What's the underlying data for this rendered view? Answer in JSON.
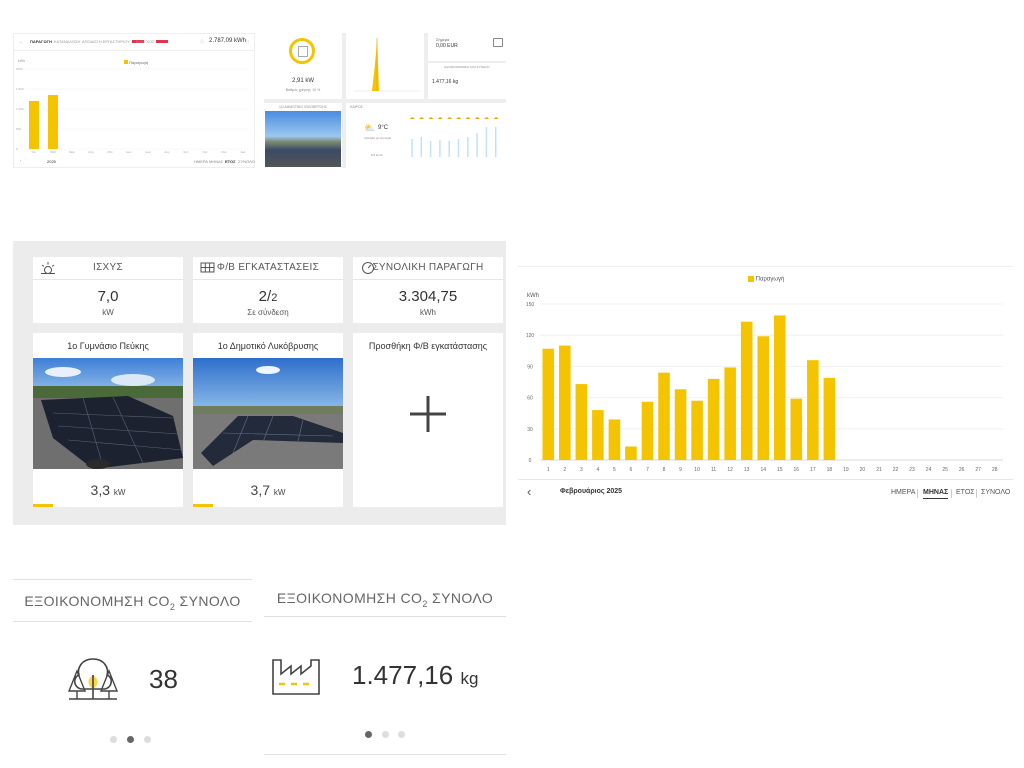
{
  "mini_top_left": {
    "tabs": [
      "ΠΑΡΑΓΩΓΗ",
      "ΚΑΤΑΝΑΛΩΣΗ",
      "ΑΠΟΔΟΣΗ ΕΡΓΑΣΤΗΡΙΟΥ",
      "ΕΛΕΓΧΟΣ"
    ],
    "total": "2.787,09 kWh",
    "legend": "Παραγωγή",
    "y_unit": "kWh",
    "y_ticks": [
      "2000",
      "1.500",
      "1.000",
      "500",
      "0"
    ],
    "months": [
      "Ιαν",
      "Φεβ",
      "Μαρ",
      "Απρ",
      "Μαϊ",
      "Ιουν",
      "Ιουλ",
      "Αυγ",
      "Σεπ",
      "Οκτ",
      "Νοε",
      "Δεκ"
    ],
    "year": "2025",
    "nav": [
      "ΗΜΕΡΑ",
      "ΜΗΝΑΣ",
      "ΕΤΟΣ",
      "ΣΥΝΟΛΟ"
    ],
    "active_nav": "ΕΤΟΣ"
  },
  "mini_top_right": {
    "power": "2,91 kW",
    "efficiency": "Βαθμός χρήσης: 19 %",
    "today_label": "Σήμερα",
    "today_value": "0,00 EUR",
    "co2_label": "ΕΞΟΙΚΟΝΟΜΗΣΗ CO2 ΣΥΝΟΛΟ",
    "co2_value": "1.477,16 kg",
    "school_label": "1Ο ΔΗΜΟΤΙΚΟ ΛΥΚΟΒΡΥΣΗΣ",
    "weather_label": "ΚΑΙΡΟΣ",
    "temp": "9°C",
    "weather_desc": "Λιακάδα με σύννεφα",
    "wind": "8.0 km/h"
  },
  "cards": {
    "power": {
      "title": "ΙΣΧΥΣ",
      "value": "7,0",
      "unit": "kW"
    },
    "plants": {
      "title": "Φ/Β ΕΓΚΑΤΑΣΤΑΣΕΙΣ",
      "value": "2/",
      "value_suffix": "2",
      "status": "Σε σύνδεση"
    },
    "total": {
      "title": "ΣΥΝΟΛΙΚΗ ΠΑΡΑΓΩΓΗ",
      "value": "3.304,75",
      "unit": "kWh"
    }
  },
  "plants": [
    {
      "name": "1ο Γυμνάσιο Πεύκης",
      "value": "3,3",
      "unit": "kW"
    },
    {
      "name": "1ο Δημοτικό Λυκόβρυσης",
      "value": "3,7",
      "unit": "kW"
    }
  ],
  "add_plant": {
    "label": "Προσθήκη Φ/Β εγκατάστασης",
    "icon": "plus-icon"
  },
  "chart_data": {
    "type": "bar",
    "title": "",
    "legend": "Παραγωγή",
    "ylabel": "kWh",
    "xlabel": "",
    "ylim": [
      0,
      150
    ],
    "y_ticks": [
      0,
      30,
      60,
      90,
      120,
      150
    ],
    "categories": [
      "1",
      "2",
      "3",
      "4",
      "5",
      "6",
      "7",
      "8",
      "9",
      "10",
      "11",
      "12",
      "13",
      "14",
      "15",
      "16",
      "17",
      "18",
      "19",
      "20",
      "21",
      "22",
      "23",
      "24",
      "25",
      "26",
      "27",
      "28"
    ],
    "values": [
      107,
      110,
      73,
      48,
      39,
      13,
      56,
      84,
      68,
      57,
      78,
      89,
      133,
      119,
      139,
      59,
      96,
      79,
      0,
      0,
      0,
      0,
      0,
      0,
      0,
      0,
      0,
      0
    ],
    "grid": true,
    "color": "#f5c400"
  },
  "chart_nav": {
    "period": "Φεβρουάριος 2025",
    "tabs": [
      "ΗΜΕΡΑ",
      "ΜΗΝΑΣ",
      "ΕΤΟΣ",
      "ΣΥΝΟΛΟ"
    ],
    "active": "ΜΗΝΑΣ"
  },
  "co2_left": {
    "title_pre": "ΕΞΟΙΚΟΝΟΜΗΣΗ CO",
    "title_sub": "2",
    "title_post": " ΣΥΝΟΛΟ",
    "value": "38",
    "icon": "trees-icon"
  },
  "co2_right": {
    "title_pre": "ΕΞΟΙΚΟΝΟΜΗΣΗ CO",
    "title_sub": "2",
    "title_post": " ΣΥΝΟΛΟ",
    "value": "1.477,16",
    "unit": "kg",
    "icon": "factory-icon"
  },
  "colors": {
    "accent": "#f5c400",
    "panel_bg": "#ececec",
    "badge_red": "#e2334a"
  }
}
